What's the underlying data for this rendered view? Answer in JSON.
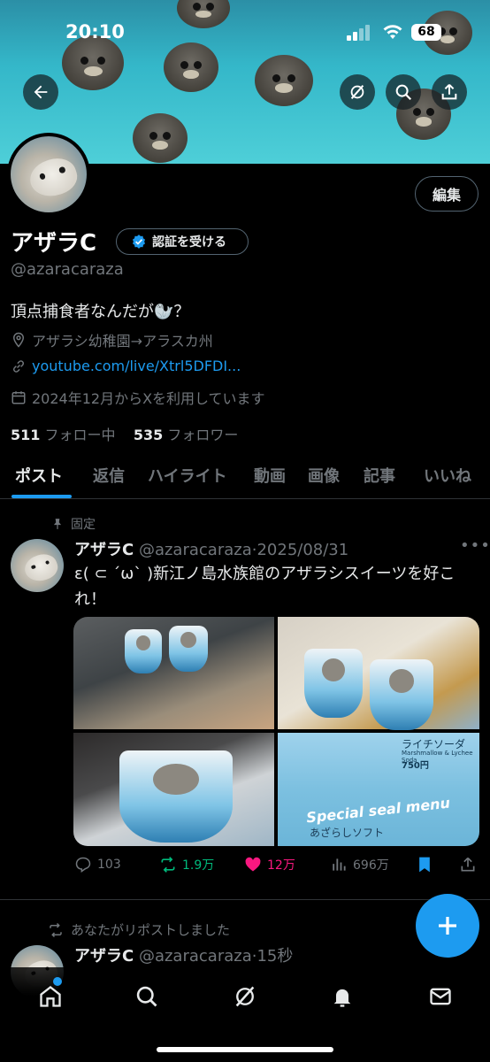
{
  "status_bar": {
    "time": "20:10",
    "battery": "68"
  },
  "profile": {
    "display_name": "アザラC",
    "verify_label": "認証を受ける",
    "edit_label": "編集",
    "handle": "@azaracaraza",
    "bio": "頂点捕食者なんだが🦭？",
    "location": "アザラシ幼稚園→アラスカ州",
    "link": "youtube.com/live/Xtrl5DFDI...",
    "joined": "2024年12月からXを利用しています",
    "following_count": "511",
    "following_label": "フォロー中",
    "followers_count": "535",
    "followers_label": "フォロワー"
  },
  "tabs": [
    {
      "label": "ポスト"
    },
    {
      "label": "返信"
    },
    {
      "label": "ハイライト"
    },
    {
      "label": "動画"
    },
    {
      "label": "画像"
    },
    {
      "label": "記事"
    },
    {
      "label": "いいね"
    }
  ],
  "post1": {
    "pinned_label": "固定",
    "name": "アザラC",
    "handle": "@azaracaraza",
    "date": "2025/08/31",
    "text": "ε( ⊂ ´ω` )新江ノ島水族館のアザラシスイーツを好これ！",
    "media_text": {
      "flavor": "ライチソーダ",
      "sub": "Marshmallow & Lychee Soda",
      "price": "750円",
      "menu_title": "Special seal menu",
      "soft": "あざらしソフト"
    },
    "replies": "103",
    "reposts": "1.9万",
    "likes": "12万",
    "views": "696万"
  },
  "post2": {
    "repost_note": "あなたがリポストしました",
    "name": "アザラC",
    "handle": "@azaracaraza",
    "time": "15秒"
  },
  "colors": {
    "accent": "#1d9bf0",
    "retweet": "#00ba7c",
    "like": "#f91880"
  }
}
